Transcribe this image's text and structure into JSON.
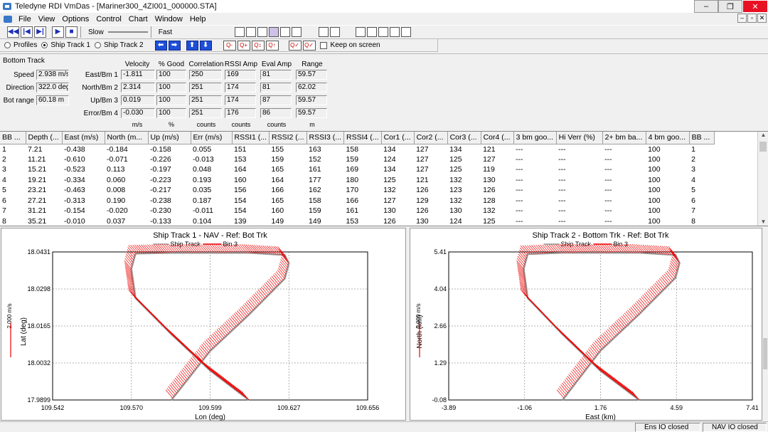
{
  "window": {
    "title": "Teledyne RDI VmDas - [Mariner300_4ZI001_000000.STA]",
    "controls": [
      "–",
      "❐",
      "✕"
    ]
  },
  "menu": {
    "items": [
      "File",
      "View",
      "Options",
      "Control",
      "Chart",
      "Window",
      "Help"
    ],
    "mdi_controls": [
      "–",
      "▫",
      "✕"
    ]
  },
  "toolbar": {
    "speed_slow": "Slow",
    "speed_fast": "Fast",
    "view_options": {
      "profiles": "Profiles",
      "ship_track_1": "Ship Track 1",
      "ship_track_2": "Ship Track 2",
      "selected": "Ship Track 1"
    },
    "keep_on_screen": "Keep on screen"
  },
  "bottom_track": {
    "title": "Bottom Track",
    "summary": [
      {
        "label": "Speed",
        "value": "2.938 m/s"
      },
      {
        "label": "Direction",
        "value": "322.0 deg"
      },
      {
        "label": "Bot range",
        "value": "60.18 m"
      }
    ],
    "headers": [
      "Velocity",
      "% Good",
      "Correlation",
      "RSSI Amp",
      "Eval Amp",
      "Range"
    ],
    "units": [
      "m/s",
      "%",
      "counts",
      "counts",
      "counts",
      "m"
    ],
    "rows": [
      {
        "label": "East/Bm 1",
        "values": [
          "-1.811",
          "100",
          "250",
          "169",
          "81",
          "59.57"
        ]
      },
      {
        "label": "North/Bm 2",
        "values": [
          "2.314",
          "100",
          "251",
          "174",
          "81",
          "62.02"
        ]
      },
      {
        "label": "Up/Bm 3",
        "values": [
          "0.019",
          "100",
          "251",
          "174",
          "87",
          "59.57"
        ]
      },
      {
        "label": "Error/Bm 4",
        "values": [
          "-0.030",
          "100",
          "251",
          "176",
          "86",
          "59.57"
        ]
      }
    ]
  },
  "grid": {
    "columns": [
      "BB ...",
      "Depth (...",
      "East (m/s)",
      "North (m...",
      "Up (m/s)",
      "Err (m/s)",
      "RSSI1 (...",
      "RSSI2 (...",
      "RSSI3 (...",
      "RSSI4 (...",
      "Cor1 (...",
      "Cor2 (...",
      "Cor3 (...",
      "Cor4 (...",
      "3 bm goo...",
      "Hi Verr (%)",
      "2+ bm ba...",
      "4 bm goo...",
      "BB ..."
    ],
    "rows": [
      [
        "1",
        "7.21",
        "-0.438",
        "-0.184",
        "-0.158",
        "0.055",
        "151",
        "155",
        "163",
        "158",
        "134",
        "127",
        "134",
        "121",
        "---",
        "---",
        "---",
        "100",
        "1"
      ],
      [
        "2",
        "11.21",
        "-0.610",
        "-0.071",
        "-0.226",
        "-0.013",
        "153",
        "159",
        "152",
        "159",
        "124",
        "127",
        "125",
        "127",
        "---",
        "---",
        "---",
        "100",
        "2"
      ],
      [
        "3",
        "15.21",
        "-0.523",
        "0.113",
        "-0.197",
        "0.048",
        "164",
        "165",
        "161",
        "169",
        "134",
        "127",
        "125",
        "119",
        "---",
        "---",
        "---",
        "100",
        "3"
      ],
      [
        "4",
        "19.21",
        "-0.334",
        "0.060",
        "-0.223",
        "0.193",
        "160",
        "164",
        "177",
        "180",
        "125",
        "121",
        "132",
        "130",
        "---",
        "---",
        "---",
        "100",
        "4"
      ],
      [
        "5",
        "23.21",
        "-0.463",
        "0.008",
        "-0.217",
        "0.035",
        "156",
        "166",
        "162",
        "170",
        "132",
        "126",
        "123",
        "126",
        "---",
        "---",
        "---",
        "100",
        "5"
      ],
      [
        "6",
        "27.21",
        "-0.313",
        "0.190",
        "-0.238",
        "0.187",
        "154",
        "165",
        "158",
        "166",
        "127",
        "129",
        "132",
        "128",
        "---",
        "---",
        "---",
        "100",
        "6"
      ],
      [
        "7",
        "31.21",
        "-0.154",
        "-0.020",
        "-0.230",
        "-0.011",
        "154",
        "160",
        "159",
        "161",
        "130",
        "126",
        "130",
        "132",
        "---",
        "---",
        "---",
        "100",
        "7"
      ],
      [
        "8",
        "35.21",
        "-0.010",
        "0.037",
        "-0.133",
        "0.104",
        "139",
        "149",
        "149",
        "153",
        "126",
        "130",
        "124",
        "125",
        "---",
        "---",
        "---",
        "100",
        "8"
      ]
    ]
  },
  "chart_data": [
    {
      "type": "line",
      "title": "Ship Track 1 - NAV - Ref: Bot Trk",
      "xlabel": "Lon (deg)",
      "ylabel": "Lat (deg)",
      "scale_label": "2.000 m/s",
      "xlim": [
        109.542,
        109.656
      ],
      "ylim": [
        17.9899,
        18.0431
      ],
      "xticks": [
        "109.542",
        "109.570",
        "109.599",
        "109.627",
        "109.656"
      ],
      "yticks": [
        "18.0431",
        "18.0298",
        "18.0165",
        "18.0032",
        "17.9899"
      ],
      "legend": "top",
      "series": [
        {
          "name": "Ship Track",
          "color": "#999999",
          "x": [
            109.613,
            109.599,
            109.585,
            109.572,
            109.5705,
            109.572,
            109.585,
            109.599,
            109.613,
            109.626,
            109.6275,
            109.626,
            109.613,
            109.599,
            109.585
          ],
          "y": [
            17.9899,
            18.0005,
            18.0135,
            18.0265,
            18.037,
            18.0425,
            18.0428,
            18.0428,
            18.0428,
            18.042,
            18.039,
            18.0335,
            18.0205,
            18.0075,
            17.9899
          ]
        },
        {
          "name": "Bin 3",
          "color": "#ee0000"
        }
      ],
      "grid": true
    },
    {
      "type": "line",
      "title": "Ship Track 2 - Bottom Trk - Ref: Bot Trk",
      "xlabel": "East (km)",
      "ylabel": "North (km)",
      "scale_label": "2.000 m/s",
      "xlim": [
        -3.89,
        7.41
      ],
      "ylim": [
        -0.08,
        5.41
      ],
      "xticks": [
        "-3.89",
        "-1.06",
        "1.76",
        "4.59",
        "7.41"
      ],
      "yticks": [
        "5.41",
        "4.04",
        "2.66",
        "1.29",
        "-0.08"
      ],
      "legend": "top",
      "series": [
        {
          "name": "Ship Track",
          "color": "#999999",
          "x": [
            3.2,
            1.76,
            0.35,
            -0.95,
            -1.1,
            -0.95,
            0.35,
            1.76,
            3.2,
            4.55,
            4.7,
            4.55,
            3.2,
            1.76,
            0.35
          ],
          "y": [
            -0.08,
            1.0,
            2.35,
            3.7,
            4.78,
            5.33,
            5.38,
            5.38,
            5.38,
            5.3,
            5.0,
            4.45,
            3.1,
            1.75,
            -0.08
          ]
        },
        {
          "name": "Bin 3",
          "color": "#ee0000"
        }
      ],
      "grid": true
    }
  ],
  "status": {
    "ens_io": "Ens IO closed",
    "nav_io": "NAV IO closed"
  },
  "colors": {
    "track": "#999999",
    "bin": "#ee0000",
    "accent": "#1e4fd8"
  }
}
